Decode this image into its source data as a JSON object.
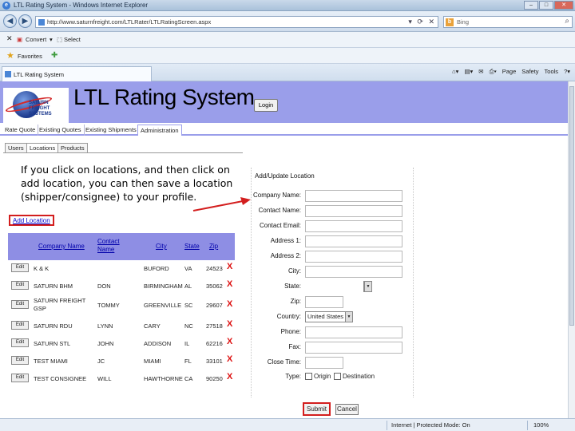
{
  "browser": {
    "window_title": "LTL Rating System - Windows Internet Explorer",
    "url": "http://www.saturnfreight.com/LTLRater/LTLRatingScreen.aspx",
    "search_placeholder": "Bing",
    "command_items": [
      "Convert",
      "Select"
    ],
    "favorites_label": "Favorites",
    "tab_title": "LTL Rating System",
    "toolbar_items": [
      "Page",
      "Safety",
      "Tools"
    ],
    "status_zone": "Internet | Protected Mode: On",
    "zoom": "100%"
  },
  "app": {
    "logo_text": "SATURN FREIGHT SYSTEMS",
    "title": "LTL Rating System",
    "login_label": "Login",
    "main_tabs": [
      "Rate Quote",
      "Existing Quotes",
      "Existing Shipments",
      "Administration"
    ],
    "active_main_tab": "Administration",
    "sub_tabs": [
      "Users",
      "Locations",
      "Products"
    ],
    "active_sub_tab": "Locations"
  },
  "annotation": "If you click on locations, and then click on add location, you can then save a location (shipper/consignee) to your profile.",
  "locations": {
    "add_label": "Add Location",
    "edit_label": "Edit",
    "delete_label": "X",
    "headers": {
      "company": "Company Name",
      "contact": "Contact Name",
      "city": "City",
      "state": "State",
      "zip": "Zip"
    },
    "rows": [
      {
        "company": "K & K",
        "contact": "",
        "city": "BUFORD",
        "state": "VA",
        "zip": "24523"
      },
      {
        "company": "SATURN BHM",
        "contact": "DON",
        "city": "BIRMINGHAM",
        "state": "AL",
        "zip": "35062"
      },
      {
        "company": "SATURN FREIGHT GSP",
        "contact": "TOMMY",
        "city": "GREENVILLE",
        "state": "SC",
        "zip": "29607"
      },
      {
        "company": "SATURN RDU",
        "contact": "LYNN",
        "city": "CARY",
        "state": "NC",
        "zip": "27518"
      },
      {
        "company": "SATURN STL",
        "contact": "JOHN",
        "city": "ADDISON",
        "state": "IL",
        "zip": "62216"
      },
      {
        "company": "TEST MIAMI",
        "contact": "JC",
        "city": "MIAMI",
        "state": "FL",
        "zip": "33101"
      },
      {
        "company": "TEST CONSIGNEE",
        "contact": "WILL",
        "city": "HAWTHORNE",
        "state": "CA",
        "zip": "90250"
      }
    ]
  },
  "form": {
    "title": "Add/Update Location",
    "labels": {
      "company": "Company Name:",
      "contact": "Contact Name:",
      "email": "Contact Email:",
      "address1": "Address 1:",
      "address2": "Address 2:",
      "city": "City:",
      "state": "State:",
      "zip": "Zip:",
      "country": "Country:",
      "phone": "Phone:",
      "fax": "Fax:",
      "close_time": "Close Time:",
      "type": "Type:"
    },
    "country_value": "United States",
    "type_options": [
      "Origin",
      "Destination"
    ],
    "submit_label": "Submit",
    "cancel_label": "Cancel"
  },
  "colors": {
    "banner": "#9a9eea",
    "table_header": "#8e8ee4",
    "highlight": "#d31e1e"
  }
}
